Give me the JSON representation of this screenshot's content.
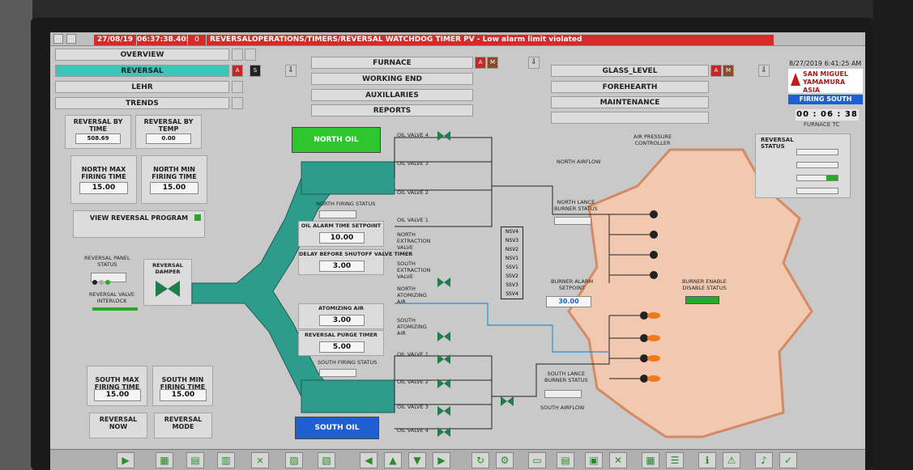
{
  "alarm": {
    "date": "27/08/19",
    "time": "06:37:38.405",
    "count": "0",
    "message": "REVERSALOPERATIONS/TIMERS/REVERSAL WATCHDOG TIMER PV - Low alarm limit violated"
  },
  "nav": {
    "overview": "OVERVIEW",
    "reversal": "REVERSAL",
    "lehr": "LEHR",
    "trends": "TRENDS",
    "furnace": "FURNACE",
    "working_end": "WORKING END",
    "auxillaries": "AUXILLARIES",
    "reports": "REPORTS",
    "glass_level": "GLASS_LEVEL",
    "forehearth": "FOREHEARTH",
    "maintenance": "MAINTENANCE",
    "reversal_flags": [
      "A",
      "S"
    ],
    "furnace_flags": [
      "A",
      "M"
    ],
    "glass_flags": [
      "A",
      "M"
    ]
  },
  "header_right": {
    "datetime": "8/27/2019 6:41:25 AM",
    "brand_line1": "SAN MIGUEL YAMAMURA",
    "brand_line2": "ASIA CORPORATION",
    "firing": "FIRING SOUTH",
    "timer": "00 : 06 : 38",
    "furnace_tc": "FURNACE TC"
  },
  "left": {
    "reversal_by_time": "REVERSAL BY TIME",
    "reversal_by_time_value": "508.69",
    "reversal_by_temp": "REVERSAL BY TEMP",
    "reversal_by_temp_value": "0.00",
    "north_max": "NORTH MAX\nFIRING TIME",
    "north_max_value": "15.00",
    "north_min": "NORTH MIN\nFIRING TIME",
    "north_min_value": "15.00",
    "view_program": "VIEW REVERSAL PROGRAM",
    "panel_status": "REVERSAL PANEL\nSTATUS",
    "valve_interlock": "REVERSAL VALVE\nINTERLOCK",
    "reversal_damper": "REVERSAL\nDAMPER",
    "south_max": "SOUTH MAX\nFIRING TIME",
    "south_max_value": "15.00",
    "south_min": "SOUTH MIN\nFIRING TIME",
    "south_min_value": "15.00",
    "reversal_now": "REVERSAL NOW",
    "reversal_mode": "REVERSAL MODE"
  },
  "center": {
    "north_oil": "NORTH OIL",
    "south_oil": "SOUTH OIL",
    "north_firing_status": "NORTH FIRING STATUS",
    "oil_alarm_setpoint_label": "OIL ALARM TIME SETPOINT",
    "oil_alarm_setpoint_value": "10.00",
    "delay_label": "DELAY BEFORE SHUTOFF VALVE TIMER",
    "delay_value": "3.00",
    "atomizing_label": "ATOMIZING AIR",
    "atomizing_value": "3.00",
    "purge_label": "REVERSAL PURGE TIMER",
    "purge_value": "5.00",
    "south_firing_status": "SOUTH FIRING STATUS",
    "north_valves": [
      "OIL VALVE 4",
      "OIL VALVE 3",
      "OIL VALVE 2",
      "OIL VALVE 1"
    ],
    "south_valves": [
      "OIL VALVE 1",
      "OIL VALVE 2",
      "OIL VALVE 3",
      "OIL VALVE 4"
    ],
    "north_extraction": "NORTH\nEXTRACTION\nVALVE",
    "south_extraction": "SOUTH\nEXTRACTION\nVALVE",
    "north_atomizing": "NORTH\nATOMIZING\nAIR",
    "south_atomizing": "SOUTH\nATOMIZING\nAIR",
    "ssv": [
      "NSV4",
      "NSV3",
      "NSV2",
      "NSV1",
      "SSV1",
      "SSV2",
      "SSV3",
      "SSV4"
    ]
  },
  "right": {
    "air_pressure": "AIR PRESSURE\nCONTROLLER",
    "north_airflow": "NORTH AIRFLOW",
    "north_lance": "NORTH LANCE\nBURNER STATUS",
    "burner_alarm": "BURNER ALARM\nSETPOINT",
    "burner_alarm_value": "30.00",
    "south_lance": "SOUTH LANCE\nBURNER STATUS",
    "south_airflow": "SOUTH AIRFLOW",
    "burner_enable": "BURNER ENABLE\nDISABLE STATUS",
    "reversal_status": "REVERSAL\nSTATUS"
  }
}
